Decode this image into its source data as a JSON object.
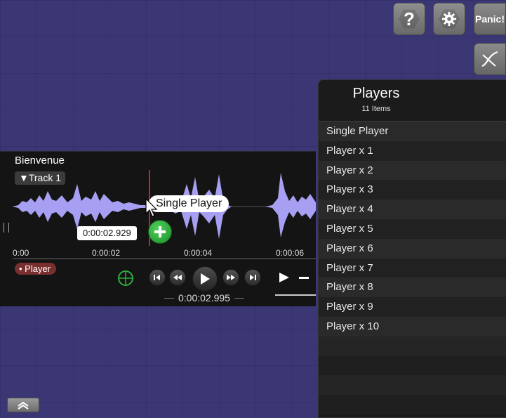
{
  "toolbar": {
    "help_label": "?",
    "panic_label": "Panic!"
  },
  "track": {
    "title": "Bienvenue",
    "track_label": "▼Track 1",
    "cursor_time": "0:00:02.929",
    "drag_label": "Single Player",
    "ruler": [
      "0:00",
      "0:00:02",
      "0:00:04",
      "0:00:06"
    ],
    "player_label": "• Player",
    "position_time": "0:00:02.995"
  },
  "players_panel": {
    "title": "Players",
    "count": "11 Items",
    "items": [
      "Single Player",
      "Player x 1",
      "Player x 2",
      "Player x 3",
      "Player x 4",
      "Player x 5",
      "Player x 6",
      "Player x 7",
      "Player x 8",
      "Player x 9",
      "Player x 10"
    ]
  },
  "colors": {
    "background": "#3b3775",
    "waveform": "#a7a0f2",
    "playhead": "#d02020",
    "player_tag": "#7a2f2f",
    "add_button": "#2fae3c"
  },
  "icons": [
    "help-icon",
    "gear-icon",
    "curve-icon",
    "play-circle-icon",
    "plus-icon",
    "target-icon",
    "skip-back-icon",
    "rewind-icon",
    "play-icon",
    "fast-forward-icon",
    "skip-forward-icon",
    "chevron-up-icon"
  ]
}
